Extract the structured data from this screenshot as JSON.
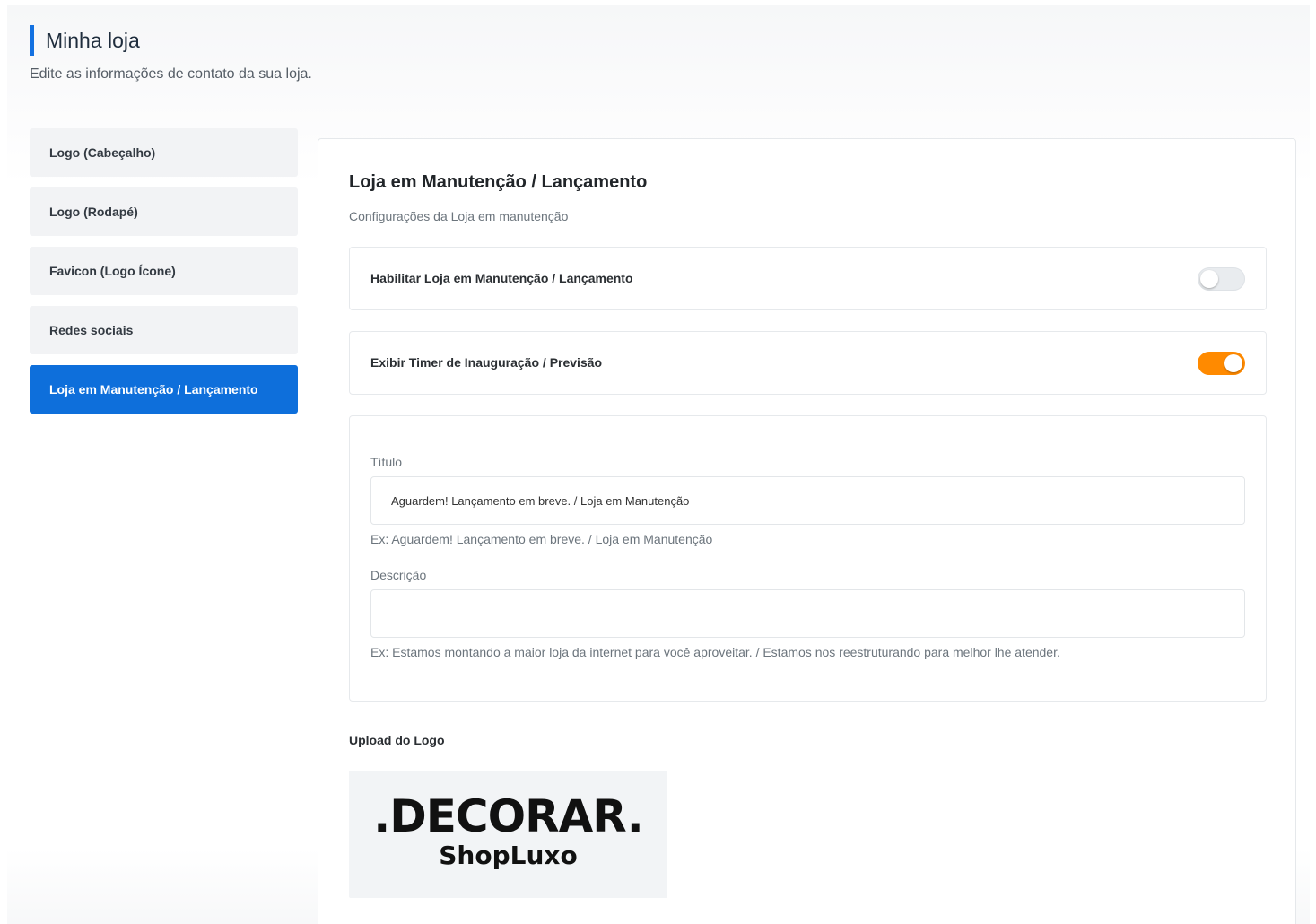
{
  "header": {
    "title": "Minha loja",
    "subtitle": "Edite as informações de contato da sua loja."
  },
  "sidebar": {
    "items": [
      {
        "label": "Logo (Cabeçalho)",
        "active": false
      },
      {
        "label": "Logo (Rodapé)",
        "active": false
      },
      {
        "label": "Favicon (Logo Ícone)",
        "active": false
      },
      {
        "label": "Redes sociais",
        "active": false
      },
      {
        "label": "Loja em Manutenção / Lançamento",
        "active": true
      }
    ]
  },
  "panel": {
    "title": "Loja em Manutenção / Lançamento",
    "subtitle": "Configurações da Loja em manutenção",
    "toggles": [
      {
        "label": "Habilitar Loja em Manutenção / Lançamento",
        "enabled": false
      },
      {
        "label": "Exibir Timer de Inauguração / Previsão",
        "enabled": true
      }
    ],
    "form": {
      "title_label": "Título",
      "title_value": "Aguardem! Lançamento em breve. / Loja em Manutenção",
      "title_hint": "Ex: Aguardem! Lançamento em breve. / Loja em Manutenção",
      "description_label": "Descrição",
      "description_value": "",
      "description_hint": "Ex: Estamos montando a maior loja da internet para você aproveitar. / Estamos nos reestruturando para melhor lhe atender."
    },
    "upload": {
      "label": "Upload do Logo",
      "logo_text_main": ".DECORAR.",
      "logo_text_sub": "ShopLuxo"
    }
  },
  "colors": {
    "accent": "#0e6fdb",
    "toggle_on": "#ff8a00"
  }
}
